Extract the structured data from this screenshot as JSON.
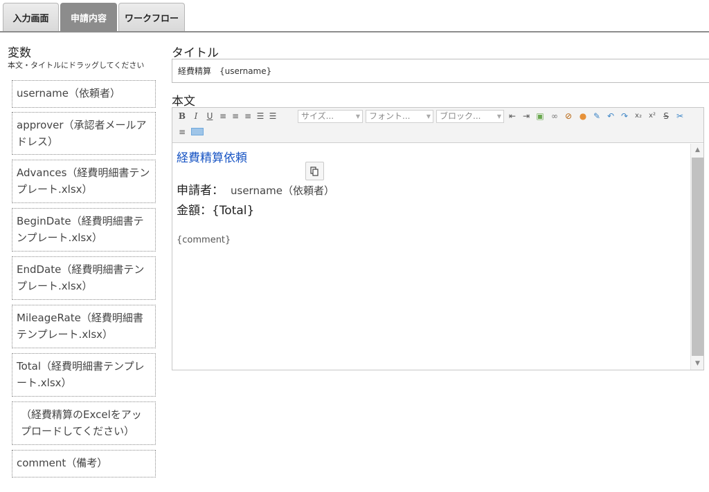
{
  "tabs": [
    {
      "label": "入力画面"
    },
    {
      "label": "申請内容"
    },
    {
      "label": "ワークフロー"
    }
  ],
  "active_tab": "申請内容",
  "variables": {
    "title": "変数",
    "hint": "本文・タイトルにドラッグしてください",
    "items": [
      {
        "label": "username（依頼者）"
      },
      {
        "label": "approver（承認者メールアドレス）"
      },
      {
        "label": "Advances（経費明細書テンプレート.xlsx）"
      },
      {
        "label": "BeginDate（経費明細書テンプレート.xlsx）"
      },
      {
        "label": "EndDate（経費明細書テンプレート.xlsx）"
      },
      {
        "label": "MileageRate（経費明細書テンプレート.xlsx）"
      },
      {
        "label": "Total（経費明細書テンプレート.xlsx）"
      },
      {
        "label": "（経費精算のExcelをアップロードしてください）"
      },
      {
        "label": "comment（備考）"
      }
    ]
  },
  "title_field": {
    "label": "タイトル",
    "value": "経費精算　{username}"
  },
  "body": {
    "label": "本文",
    "toolbar": {
      "size_select": "サイズ...",
      "font_select": "フォント...",
      "block_select": "ブロック..."
    },
    "content": {
      "heading": "経費精算依頼",
      "applicant_label": "申請者：",
      "applicant_value": "username（依頼者）",
      "amount_line": "金額：{Total}",
      "comment": "{comment}"
    }
  },
  "colors": {
    "active_tab_bg": "#8c8c8c",
    "heading_blue": "#1a56c4"
  }
}
